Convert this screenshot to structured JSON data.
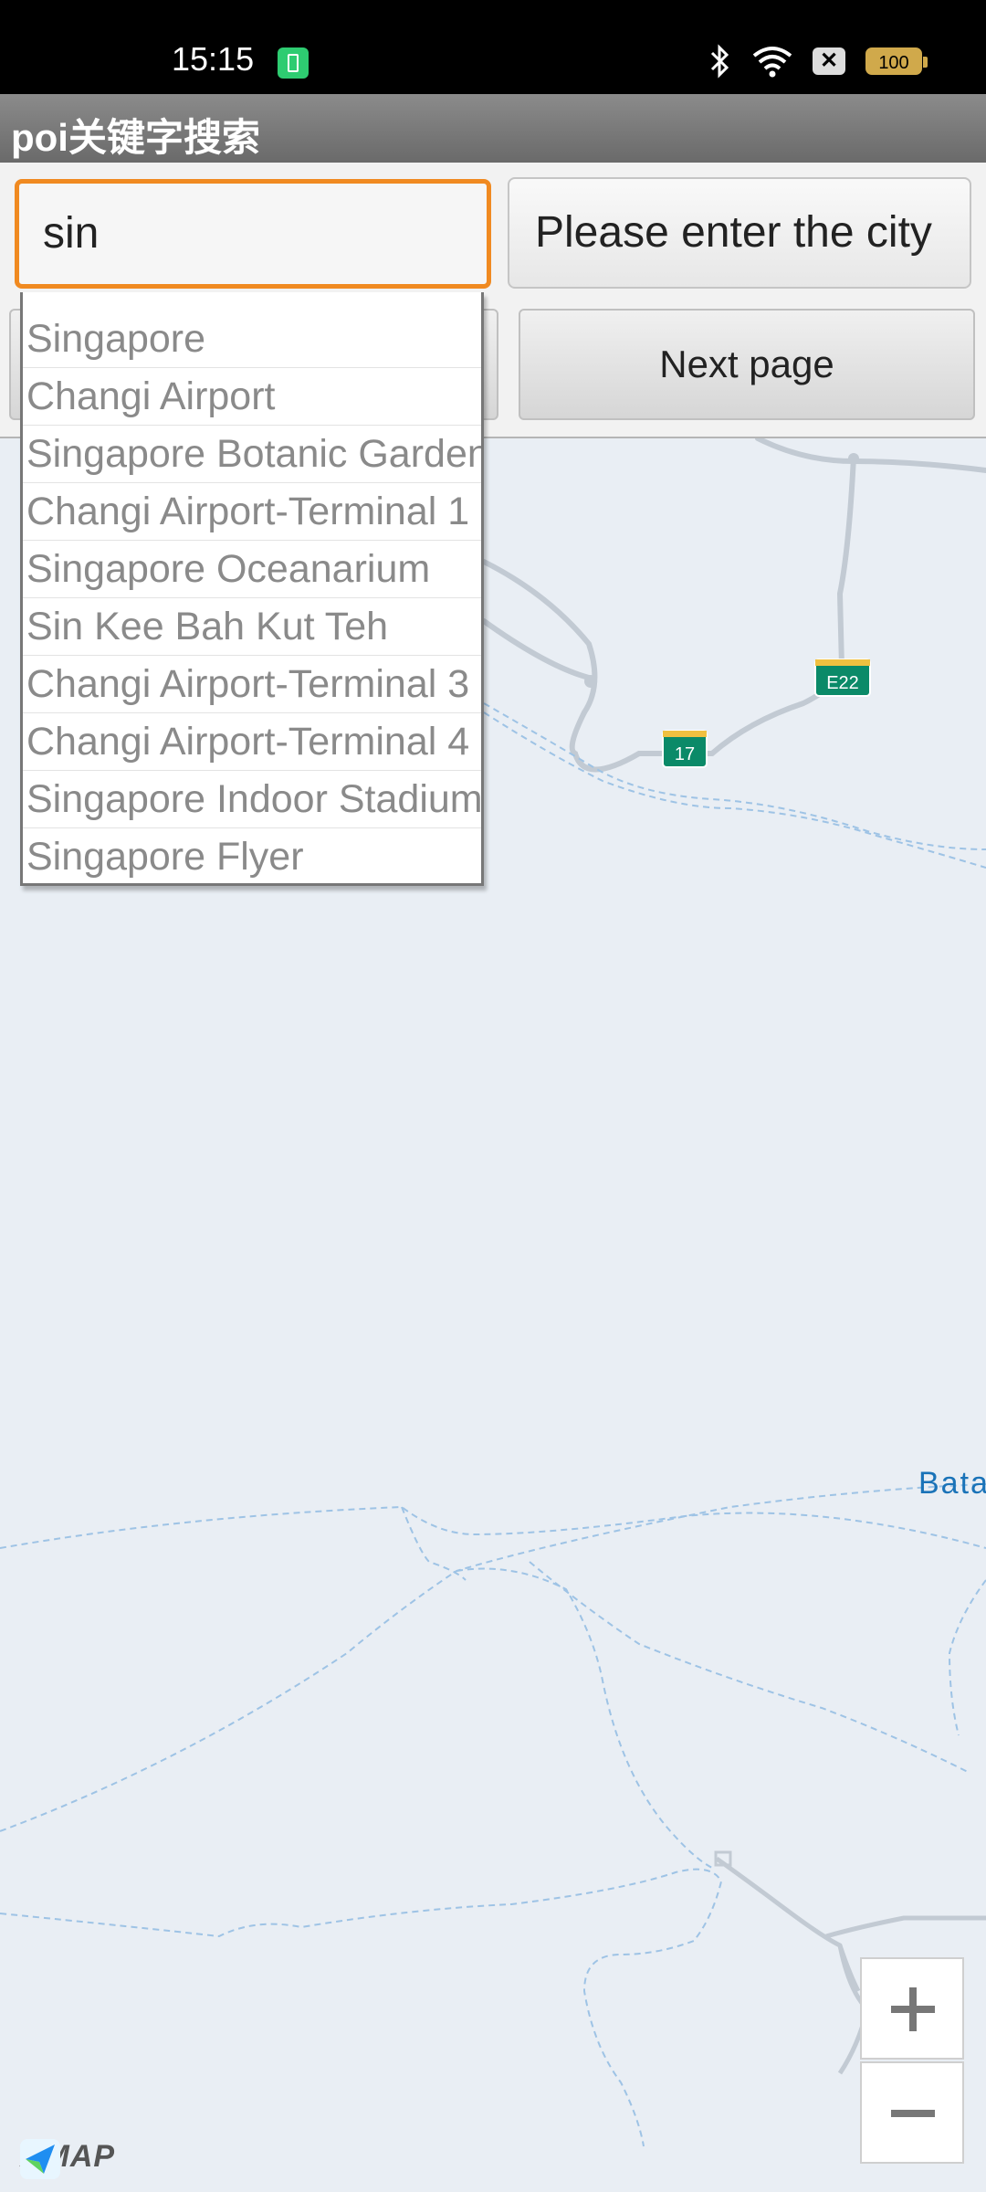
{
  "status_bar": {
    "time": "15:15",
    "battery": "100",
    "close_glyph": "✕"
  },
  "title_bar": {
    "title": "poi关键字搜索"
  },
  "search": {
    "keyword": "sin",
    "city_placeholder": "Please enter the city"
  },
  "buttons": {
    "next_page": "Next page"
  },
  "suggestions": [
    "Singapore",
    "Changi Airport",
    "Singapore Botanic Gardens",
    "Changi Airport-Terminal 1",
    "Singapore Oceanarium",
    "Sin Kee Bah Kut Teh",
    "Changi Airport-Terminal 3",
    "Changi Airport-Terminal 4",
    "Singapore Indoor Stadium",
    "Singapore Flyer"
  ],
  "map": {
    "road_badges": [
      "E22",
      "17"
    ],
    "place_label": "Bata",
    "attribution": "AMAP",
    "colors": {
      "water": "#e9eef4",
      "road": "#c2cad3",
      "route_badge": "#0b8a68",
      "focus": "#f08a21"
    }
  }
}
